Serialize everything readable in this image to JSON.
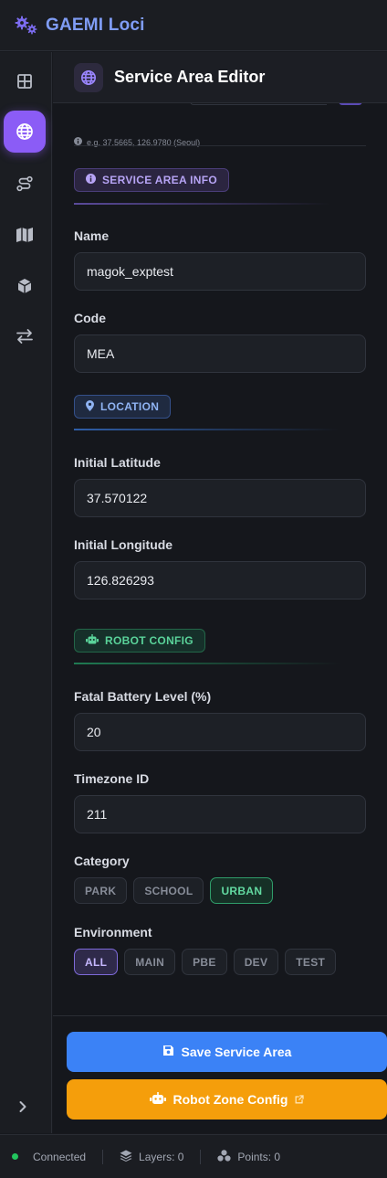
{
  "app": {
    "title": "GAEMI Loci"
  },
  "rail": {
    "items": [
      {
        "name": "dashboard",
        "icon": "grid-icon",
        "active": false
      },
      {
        "name": "service-area",
        "icon": "globe-icon",
        "active": true
      },
      {
        "name": "routes",
        "icon": "route-icon",
        "active": false
      },
      {
        "name": "map",
        "icon": "map-icon",
        "active": false
      },
      {
        "name": "objects",
        "icon": "cube-icon",
        "active": false
      },
      {
        "name": "transfer",
        "icon": "swap-arrows-icon",
        "active": false
      }
    ],
    "expand_icon": "chevron-right-icon"
  },
  "editor": {
    "title": "Service Area Editor",
    "coord_hint": "e.g. 37.5665, 126.9780 (Seoul)",
    "sections": {
      "info": "SERVICE AREA INFO",
      "location": "LOCATION",
      "robot": "ROBOT CONFIG"
    },
    "fields": {
      "name": {
        "label": "Name",
        "value": "magok_exptest"
      },
      "code": {
        "label": "Code",
        "value": "MEA"
      },
      "lat": {
        "label": "Initial Latitude",
        "value": "37.570122"
      },
      "lng": {
        "label": "Initial Longitude",
        "value": "126.826293"
      },
      "battery": {
        "label": "Fatal Battery Level (%)",
        "value": "20"
      },
      "timezone": {
        "label": "Timezone ID",
        "value": "211"
      }
    },
    "category": {
      "label": "Category",
      "options": [
        "PARK",
        "SCHOOL",
        "URBAN"
      ],
      "selected": "URBAN"
    },
    "environment": {
      "label": "Environment",
      "options": [
        "ALL",
        "MAIN",
        "PBE",
        "DEV",
        "TEST"
      ],
      "selected": "ALL"
    },
    "actions": {
      "save": "Save Service Area",
      "robot_zone": "Robot Zone Config"
    }
  },
  "status": {
    "connection": "Connected",
    "layers": "Layers: 0",
    "points": "Points: 0"
  },
  "colors": {
    "accent": "#8b5cf6",
    "primary_button": "#3b82f6",
    "secondary_button": "#f59e0b",
    "connected": "#22c55e"
  }
}
